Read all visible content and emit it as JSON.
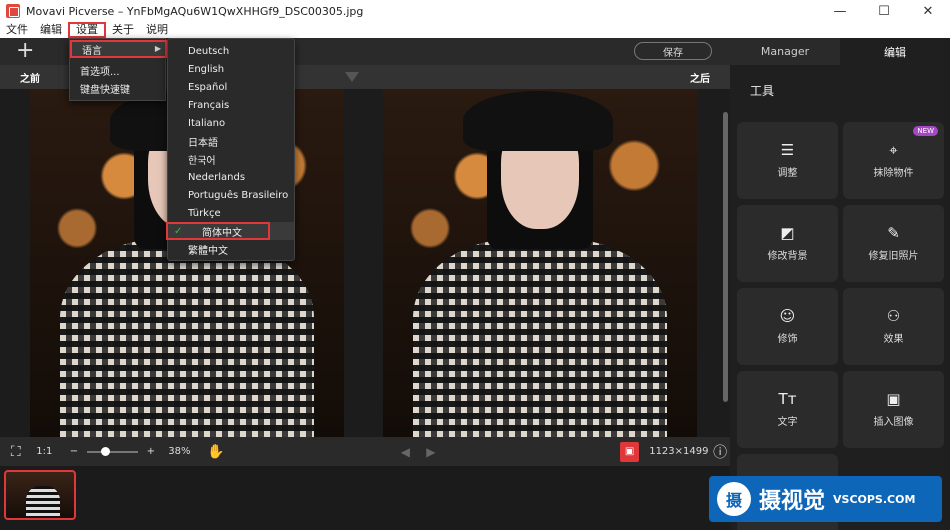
{
  "window": {
    "title": "Movavi Picverse – YnFbMgAQu6W1QwXHHGf9_DSC00305.jpg",
    "minimize": "—",
    "maximize": "☐",
    "close": "✕"
  },
  "menubar": {
    "items": [
      "文件",
      "编辑",
      "设置",
      "关于",
      "说明"
    ]
  },
  "toolbar": {
    "plus": "+",
    "save": "保存"
  },
  "tabs": {
    "manager": "Manager",
    "edit": "编辑"
  },
  "compare": {
    "before": "之前",
    "after": "之后"
  },
  "settings_menu": {
    "items": [
      "语言",
      "首选项...",
      "键盘快速键"
    ],
    "submenu_arrow": "▶"
  },
  "language_menu": {
    "items": [
      "Deutsch",
      "English",
      "Español",
      "Français",
      "Italiano",
      "日本語",
      "한국어",
      "Nederlands",
      "Português Brasileiro",
      "Türkçe",
      "简体中文",
      "繁體中文"
    ],
    "selected": 10,
    "checkmark": "✓"
  },
  "bottom_bar": {
    "fit": "⛶",
    "ratio": "1:1",
    "zoom_out": "−",
    "zoom_in": "+",
    "zoom": "38%",
    "hand": "✋",
    "prev": "◀",
    "next": "▶",
    "dims": "1123×1499",
    "info": "ⓘ",
    "zoom_fraction": 0.38
  },
  "tools_panel": {
    "title": "工具",
    "tools": [
      {
        "label": "调整",
        "icon": "☰"
      },
      {
        "label": "抹除物件",
        "icon": "⌖",
        "badge": "NEW"
      },
      {
        "label": "修改背景",
        "icon": "◩"
      },
      {
        "label": "修复旧照片",
        "icon": "✎"
      },
      {
        "label": "修饰",
        "icon": "☺"
      },
      {
        "label": "效果",
        "icon": "⚇"
      },
      {
        "label": "文字",
        "icon": "Tт"
      },
      {
        "label": "插入图像",
        "icon": "▣"
      }
    ]
  },
  "watermark": {
    "logo": "摄",
    "cn": "摄视觉",
    "en": "VSCOPS.COM"
  },
  "colors": {
    "accent_red": "#e0373a",
    "check_green": "#3ab54a",
    "badge_purple": "#a548c5"
  }
}
